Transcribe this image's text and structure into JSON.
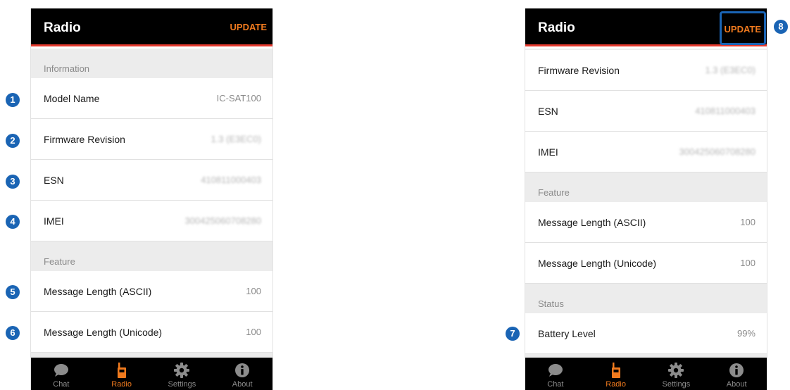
{
  "colors": {
    "accent": "#f07a1e",
    "header_divider": "#e53a2e",
    "callout": "#1a64b4",
    "bar": "#000000"
  },
  "screens": [
    {
      "title": "Radio",
      "update_label": "UPDATE",
      "info_section": "Information",
      "info_rows": [
        {
          "label": "Model Name",
          "value": "IC-SAT100"
        },
        {
          "label": "Firmware Revision",
          "value": "1.3 (E3EC0)"
        },
        {
          "label": "ESN",
          "value": "410811000403"
        },
        {
          "label": "IMEI",
          "value": "300425060708280"
        }
      ],
      "feature_section": "Feature",
      "feature_rows": [
        {
          "label": "Message Length (ASCII)",
          "value": "100"
        },
        {
          "label": "Message Length (Unicode)",
          "value": "100"
        }
      ]
    },
    {
      "title": "Radio",
      "update_label": "UPDATE",
      "info_rows": [
        {
          "label": "Firmware Revision",
          "value": "1.3 (E3EC0)"
        },
        {
          "label": "ESN",
          "value": "410811000403"
        },
        {
          "label": "IMEI",
          "value": "300425060708280"
        }
      ],
      "feature_section": "Feature",
      "feature_rows": [
        {
          "label": "Message Length (ASCII)",
          "value": "100"
        },
        {
          "label": "Message Length (Unicode)",
          "value": "100"
        }
      ],
      "status_section": "Status",
      "status_rows": [
        {
          "label": "Battery Level",
          "value": "99%"
        }
      ]
    }
  ],
  "tabs": [
    {
      "label": "Chat",
      "icon": "chat-bubble-icon"
    },
    {
      "label": "Radio",
      "icon": "radio-icon",
      "active": true
    },
    {
      "label": "Settings",
      "icon": "gear-icon"
    },
    {
      "label": "About",
      "icon": "info-icon"
    }
  ],
  "callouts": [
    "1",
    "2",
    "3",
    "4",
    "5",
    "6",
    "7",
    "8"
  ]
}
